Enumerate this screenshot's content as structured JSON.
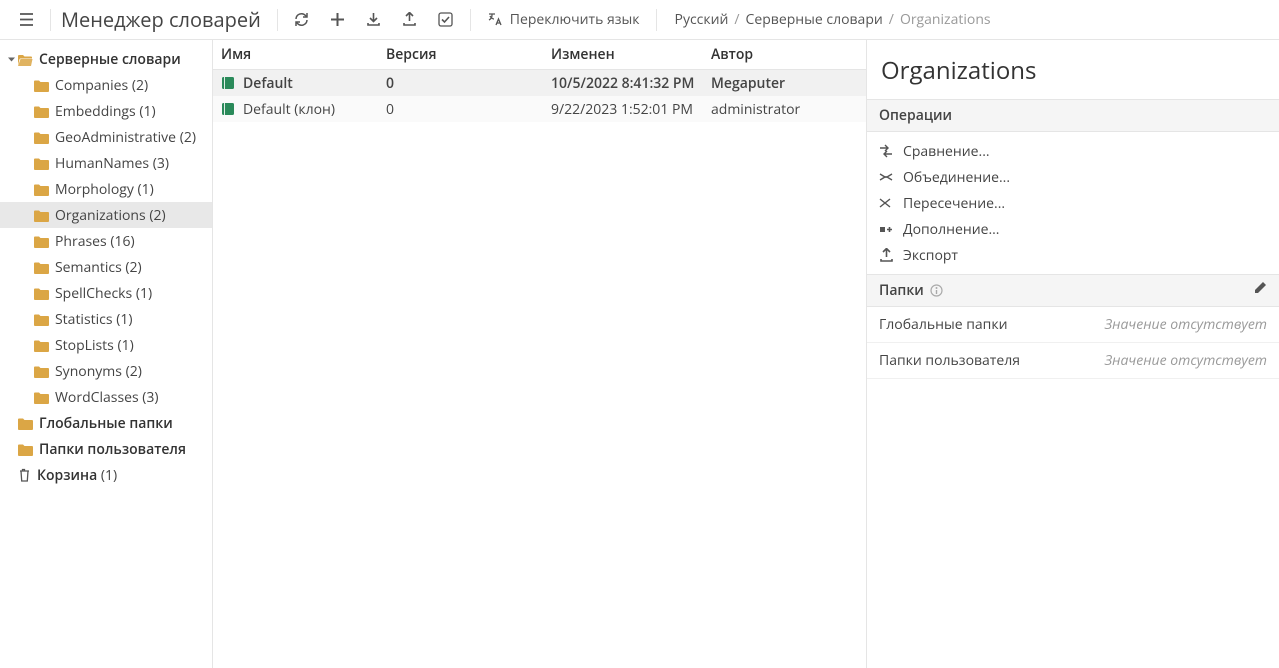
{
  "app_title": "Менеджер словарей",
  "lang_switch_label": "Переключить язык",
  "breadcrumb": [
    "Русский",
    "Серверные словари",
    "Organizations"
  ],
  "sidebar": {
    "root_label": "Серверные словари",
    "items": [
      {
        "label": "Companies",
        "count": "(2)"
      },
      {
        "label": "Embeddings",
        "count": "(1)"
      },
      {
        "label": "GeoAdministrative",
        "count": "(2)"
      },
      {
        "label": "HumanNames",
        "count": "(3)"
      },
      {
        "label": "Morphology",
        "count": "(1)"
      },
      {
        "label": "Organizations",
        "count": "(2)",
        "selected": true
      },
      {
        "label": "Phrases",
        "count": "(16)"
      },
      {
        "label": "Semantics",
        "count": "(2)"
      },
      {
        "label": "SpellChecks",
        "count": "(1)"
      },
      {
        "label": "Statistics",
        "count": "(1)"
      },
      {
        "label": "StopLists",
        "count": "(1)"
      },
      {
        "label": "Synonyms",
        "count": "(2)"
      },
      {
        "label": "WordClasses",
        "count": "(3)"
      }
    ],
    "global_label": "Глобальные папки",
    "user_label": "Папки пользователя",
    "trash_label": "Корзина",
    "trash_count": "(1)"
  },
  "table": {
    "headers": {
      "name": "Имя",
      "version": "Версия",
      "modified": "Изменен",
      "author": "Автор"
    },
    "rows": [
      {
        "name": "Default",
        "version": "0",
        "modified": "10/5/2022 8:41:32 PM",
        "author": "Megaputer",
        "selected": true
      },
      {
        "name": "Default (клон)",
        "version": "0",
        "modified": "9/22/2023 1:52:01 PM",
        "author": "administrator"
      }
    ]
  },
  "details": {
    "title": "Organizations",
    "ops_title": "Операции",
    "ops": [
      {
        "label": "Сравнение...",
        "icon": "compare"
      },
      {
        "label": "Объединение...",
        "icon": "union"
      },
      {
        "label": "Пересечение...",
        "icon": "intersect"
      },
      {
        "label": "Дополнение...",
        "icon": "complement"
      },
      {
        "label": "Экспорт",
        "icon": "export"
      }
    ],
    "folders_title": "Папки",
    "global_key": "Глобальные папки",
    "user_key": "Папки пользователя",
    "no_value": "Значение отсутствует"
  }
}
